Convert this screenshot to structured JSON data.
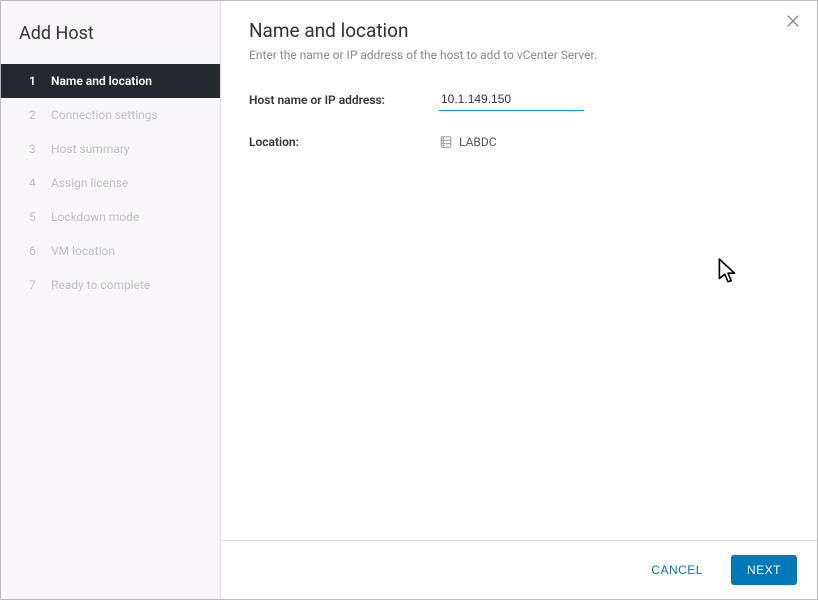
{
  "sidebar": {
    "title": "Add Host",
    "steps": [
      {
        "num": "1",
        "label": "Name and location",
        "active": true
      },
      {
        "num": "2",
        "label": "Connection settings",
        "active": false
      },
      {
        "num": "3",
        "label": "Host summary",
        "active": false
      },
      {
        "num": "4",
        "label": "Assign license",
        "active": false
      },
      {
        "num": "5",
        "label": "Lockdown mode",
        "active": false
      },
      {
        "num": "6",
        "label": "VM location",
        "active": false
      },
      {
        "num": "7",
        "label": "Ready to complete",
        "active": false
      }
    ]
  },
  "main": {
    "heading": "Name and location",
    "subheading": "Enter the name or IP address of the host to add to vCenter Server.",
    "host_label": "Host name or IP address:",
    "host_value": "10.1.149.150",
    "location_label": "Location:",
    "location_value": "LABDC"
  },
  "footer": {
    "cancel": "CANCEL",
    "next": "NEXT"
  }
}
